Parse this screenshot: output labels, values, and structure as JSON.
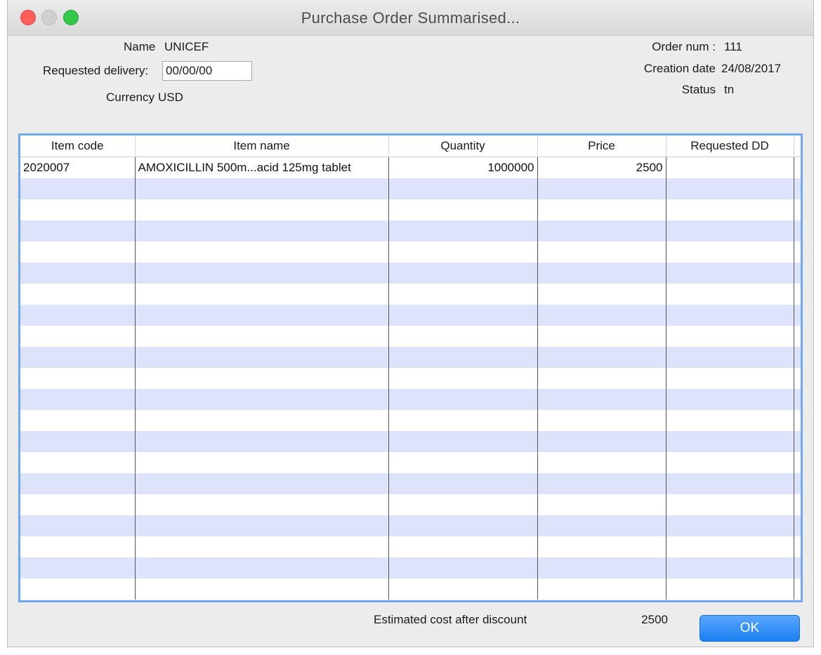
{
  "window": {
    "title": "Purchase Order Summarised..."
  },
  "header": {
    "name_label": "Name",
    "name_value": "UNICEF",
    "requested_delivery_label": "Requested delivery:",
    "requested_delivery_value": "00/00/00",
    "currency_label": "Currency",
    "currency_value": "USD",
    "order_num_label": "Order num :",
    "order_num_value": "111",
    "creation_date_label": "Creation date",
    "creation_date_value": "24/08/2017",
    "status_label": "Status",
    "status_value": "tn"
  },
  "table": {
    "columns": [
      "Item code",
      "Item name",
      "Quantity",
      "Price",
      "Requested DD"
    ],
    "rows": [
      {
        "item_code": "2020007",
        "item_name": "AMOXICILLIN 500m...acid 125mg tablet",
        "quantity": "1000000",
        "price": "2500",
        "requested_dd": ""
      }
    ]
  },
  "footer": {
    "estimated_cost_label": "Estimated cost after discount",
    "estimated_cost_value": "2500",
    "ok_label": "OK"
  },
  "colors": {
    "row_stripe": "#dde3fb",
    "focus_ring": "#6fa8f5",
    "ok_button": "#1a7ff0"
  }
}
